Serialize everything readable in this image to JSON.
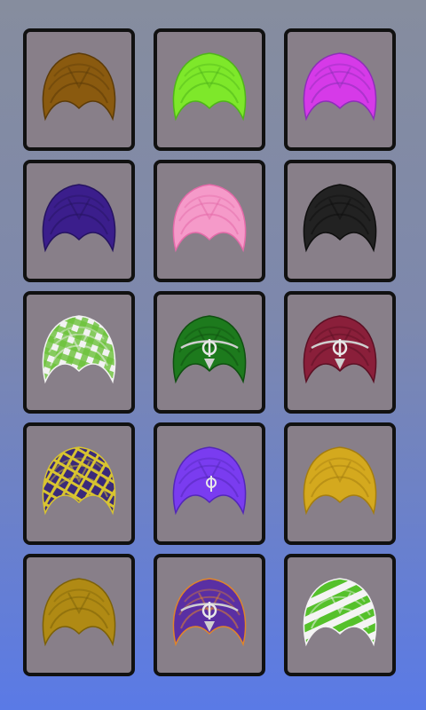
{
  "turbans": [
    {
      "icon": "turban-brown-icon",
      "color": "#8a5a0f",
      "color2": "#5c3b08",
      "pattern": "plain"
    },
    {
      "icon": "turban-lime-icon",
      "color": "#7ee82a",
      "color2": "#4fb51a",
      "pattern": "plain"
    },
    {
      "icon": "turban-magenta-icon",
      "color": "#d63ae8",
      "color2": "#8d2fb8",
      "pattern": "plain"
    },
    {
      "icon": "turban-purple-icon",
      "color": "#3b1e8c",
      "color2": "#251360",
      "pattern": "plain"
    },
    {
      "icon": "turban-pink-icon",
      "color": "#f59ac9",
      "color2": "#e36aa8",
      "pattern": "plain"
    },
    {
      "icon": "turban-black-icon",
      "color": "#222222",
      "color2": "#0e0e0e",
      "pattern": "plain"
    },
    {
      "icon": "turban-green-check-icon",
      "color": "#6cc23a",
      "color2": "#f2f2f2",
      "pattern": "check"
    },
    {
      "icon": "turban-green-khanda-icon",
      "color": "#1d7a1d",
      "color2": "#0f4f10",
      "pattern": "khanda"
    },
    {
      "icon": "turban-maroon-khanda-icon",
      "color": "#8a1f3a",
      "color2": "#5b1024",
      "pattern": "khanda"
    },
    {
      "icon": "turban-plaid-icon",
      "color": "#3a2a7a",
      "color2": "#d8c430",
      "pattern": "plaid"
    },
    {
      "icon": "turban-violet-icon",
      "color": "#7a3cf0",
      "color2": "#5327b8",
      "pattern": "pin"
    },
    {
      "icon": "turban-mustard-icon",
      "color": "#d4a91e",
      "color2": "#a47d10",
      "pattern": "plain"
    },
    {
      "icon": "turban-olive-icon",
      "color": "#b08a14",
      "color2": "#7c6108",
      "pattern": "plain"
    },
    {
      "icon": "turban-purple-orange-icon",
      "color": "#5a2fa3",
      "color2": "#e0852a",
      "pattern": "khanda"
    },
    {
      "icon": "turban-green-white-icon",
      "color": "#55c12b",
      "color2": "#f4f4f4",
      "pattern": "stripe"
    }
  ]
}
